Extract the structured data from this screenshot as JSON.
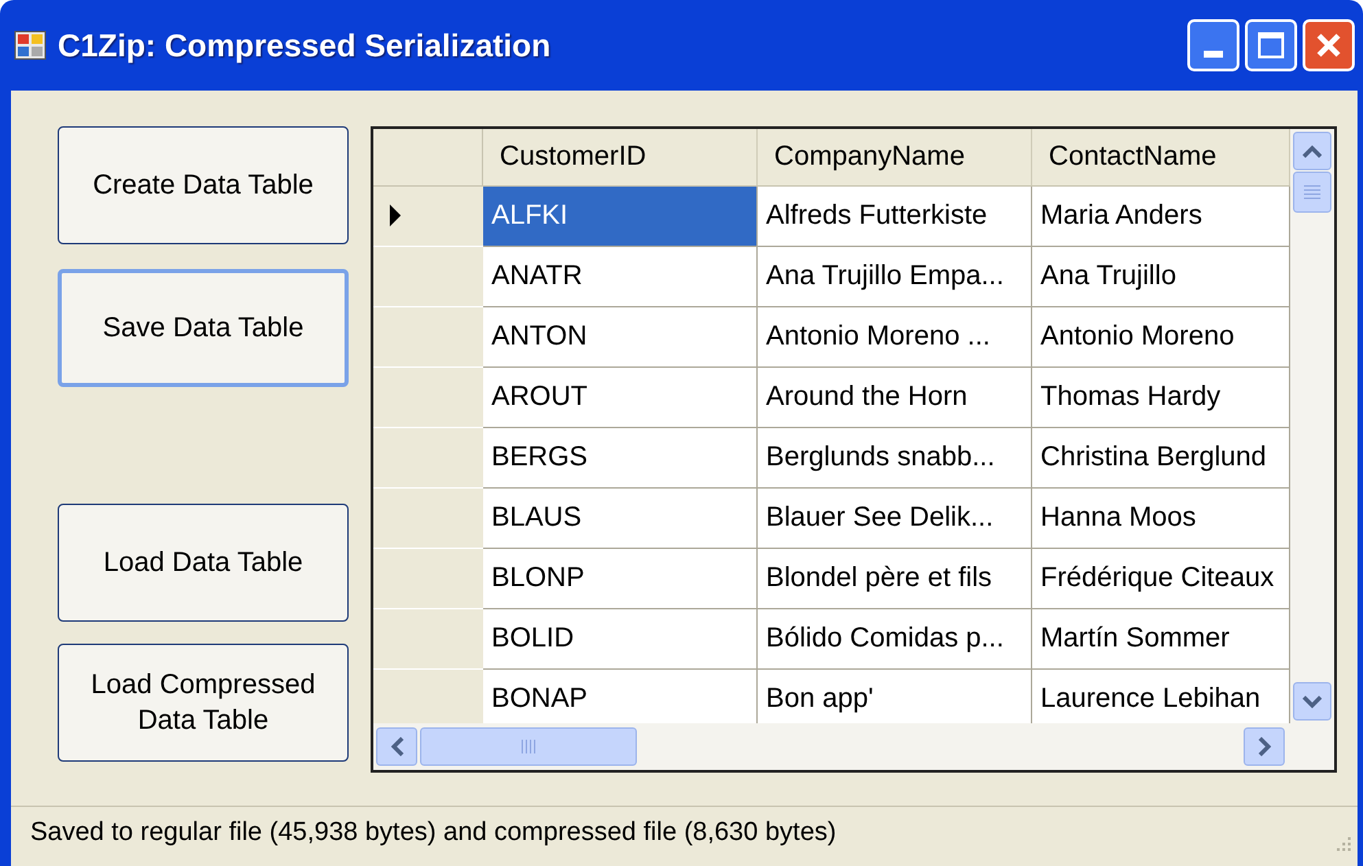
{
  "window": {
    "title": "C1Zip: Compressed Serialization"
  },
  "buttons": [
    {
      "label": "Create Data Table",
      "focused": false
    },
    {
      "label": "Save Data Table",
      "focused": true
    },
    {
      "label": "Load Data Table",
      "focused": false
    },
    {
      "label": "Load Compressed Data Table",
      "focused": false
    }
  ],
  "table": {
    "columns": [
      "CustomerID",
      "CompanyName",
      "ContactName"
    ],
    "rows": [
      {
        "selected": true,
        "cells": [
          "ALFKI",
          "Alfreds Futterkiste",
          "Maria Anders"
        ]
      },
      {
        "selected": false,
        "cells": [
          "ANATR",
          "Ana Trujillo Empa...",
          "Ana Trujillo"
        ]
      },
      {
        "selected": false,
        "cells": [
          "ANTON",
          "Antonio Moreno ...",
          "Antonio Moreno"
        ]
      },
      {
        "selected": false,
        "cells": [
          "AROUT",
          "Around the Horn",
          "Thomas Hardy"
        ]
      },
      {
        "selected": false,
        "cells": [
          "BERGS",
          "Berglunds snabb...",
          "Christina Berglund"
        ]
      },
      {
        "selected": false,
        "cells": [
          "BLAUS",
          "Blauer See Delik...",
          "Hanna Moos"
        ]
      },
      {
        "selected": false,
        "cells": [
          "BLONP",
          "Blondel père et fils",
          "Frédérique Citeaux"
        ]
      },
      {
        "selected": false,
        "cells": [
          "BOLID",
          "Bólido Comidas p...",
          "Martín Sommer"
        ]
      },
      {
        "selected": false,
        "cells": [
          "BONAP",
          "Bon app'",
          "Laurence Lebihan"
        ]
      }
    ]
  },
  "status_bar": "Saved to regular file (45,938 bytes) and compressed file (8,630 bytes)"
}
